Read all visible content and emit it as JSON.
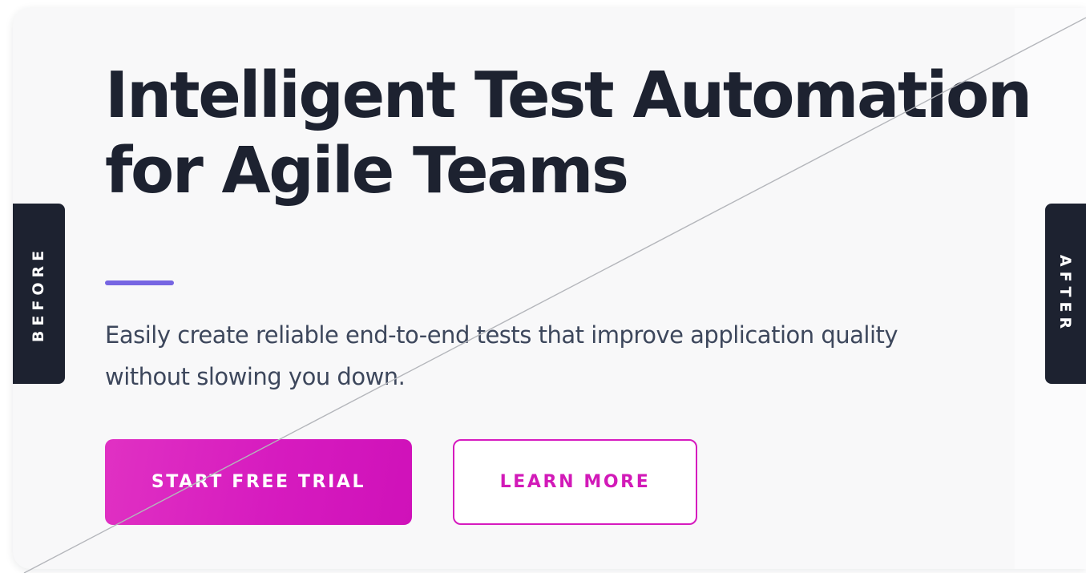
{
  "hero": {
    "headline_line1": "Intelligent Test Automation",
    "headline_line2": "for Agile Teams",
    "subtitle_line1": "Easily create reliable end-to-end tests that improve application quality",
    "subtitle_line2": "without slowing you down.",
    "primary_button_label": "START FREE TRIAL",
    "secondary_button_label": "LEARN MORE"
  },
  "comparison": {
    "before_label": "BEFORE",
    "after_label": "AFTER"
  },
  "colors": {
    "headline": "#1d2230",
    "body_text": "#3d475c",
    "accent_rule": "#7665e2",
    "brand_magenta": "#d61bbf",
    "tab_background": "#1d2230",
    "card_background": "#f8f8f9"
  }
}
